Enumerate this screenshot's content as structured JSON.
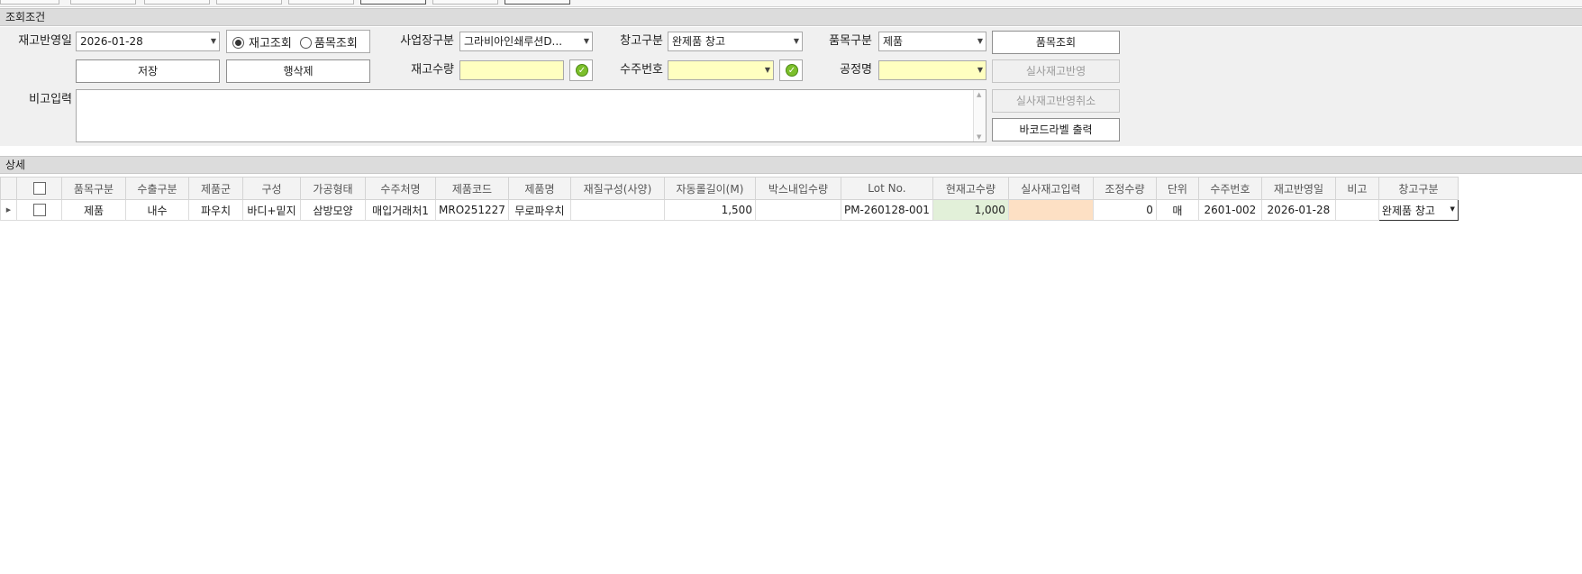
{
  "sections": {
    "query": "조회조건",
    "detail": "상세"
  },
  "query": {
    "date_label": "재고반영일",
    "date_value": "2026-01-28",
    "radio_stock": "재고조회",
    "radio_item": "품목조회",
    "site_label": "사업장구분",
    "site_value": "그라비아인쇄루션D...",
    "warehouse_label": "창고구분",
    "warehouse_value": "완제품 창고",
    "itemtype_label": "품목구분",
    "itemtype_value": "제품",
    "qty_label": "재고수량",
    "order_label": "수주번호",
    "process_label": "공정명",
    "memo_label": "비고입력"
  },
  "buttons": {
    "item_search": "품목조회",
    "save": "저장",
    "delete_row": "행삭제",
    "apply_stock": "실사재고반영",
    "cancel_stock": "실사재고반영취소",
    "barcode": "바코드라벨 출력"
  },
  "grid": {
    "columns": [
      "품목구분",
      "수출구분",
      "제품군",
      "구성",
      "가공형태",
      "수주처명",
      "제품코드",
      "제품명",
      "재질구성(사양)",
      "자동롤길이(M)",
      "박스내입수량",
      "Lot No.",
      "현재고수량",
      "실사재고입력",
      "조정수량",
      "단위",
      "수주번호",
      "재고반영일",
      "비고",
      "창고구분"
    ],
    "rows": [
      [
        "제품",
        "내수",
        "파우치",
        "바디+밑지",
        "삼방모양",
        "매입거래처1",
        "MRO251227",
        "무로파우치",
        "",
        "1,500",
        "",
        "PM-260128-001",
        "1,000",
        "",
        "0",
        "매",
        "2601-002",
        "2026-01-28",
        "",
        "완제품 창고"
      ]
    ]
  },
  "colors": {
    "section_header": "#dcdcdc",
    "required_field": "#ffffc0",
    "current_stock": "#e2f0d9",
    "actual_input": "#fde0c4"
  }
}
